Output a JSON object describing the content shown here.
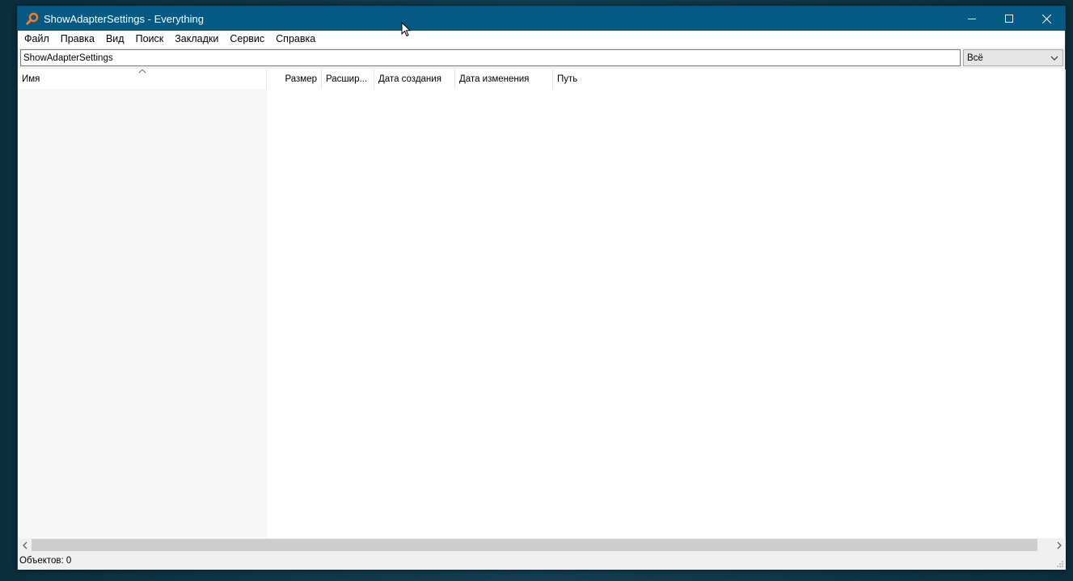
{
  "window": {
    "title": "ShowAdapterSettings - Everything",
    "app_icon": "magnifier-icon",
    "controls": [
      "minimize-icon",
      "maximize-icon",
      "close-icon"
    ]
  },
  "menu": {
    "items": [
      "Файл",
      "Правка",
      "Вид",
      "Поиск",
      "Закладки",
      "Сервис",
      "Справка"
    ]
  },
  "search": {
    "value": "ShowAdapterSettings",
    "filter_selected": "Всё"
  },
  "columns": [
    {
      "label": "Имя",
      "sorted": "ascending"
    },
    {
      "label": "Размер"
    },
    {
      "label": "Расшир..."
    },
    {
      "label": "Дата создания"
    },
    {
      "label": "Дата изменения"
    },
    {
      "label": "Путь"
    }
  ],
  "results": [],
  "status": {
    "text": "Объектов: 0"
  },
  "colors": {
    "titlebar": "#045a84",
    "desktop": "#0e3a4a",
    "name_column_bg": "#f7f7f7"
  }
}
